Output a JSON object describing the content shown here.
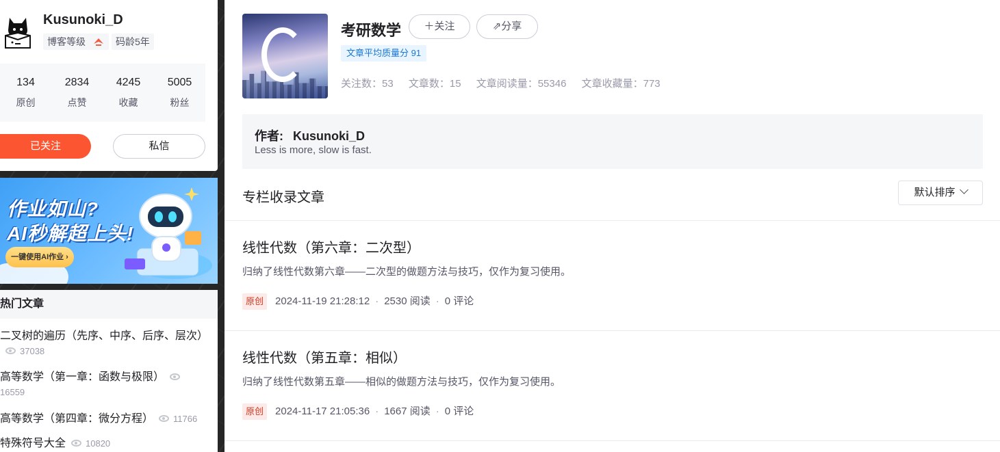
{
  "profile": {
    "name": "Kusunoki_D",
    "level_label": "博客等级",
    "age_label": "码龄5年",
    "stats": [
      {
        "num": "134",
        "label": "原创"
      },
      {
        "num": "2834",
        "label": "点赞"
      },
      {
        "num": "4245",
        "label": "收藏"
      },
      {
        "num": "5005",
        "label": "粉丝"
      }
    ],
    "followed_label": "已关注",
    "message_label": "私信"
  },
  "ad": {
    "line1": "作业如山?",
    "line2": "AI秒解超上头!",
    "cta": "一键使用AI作业 ›"
  },
  "hot": {
    "header": "热门文章",
    "items": [
      {
        "title": "二叉树的遍历（先序、中序、后序、层次）",
        "views": "37038"
      },
      {
        "title": "高等数学（第一章：函数与极限）",
        "views": "16559"
      },
      {
        "title": "高等数学（第四章：微分方程）",
        "views": "11766"
      },
      {
        "title": "特殊符号大全",
        "views": "10820"
      }
    ]
  },
  "column": {
    "title": "考研数学",
    "follow_label": "＋关注",
    "share_label": "分享",
    "quality": "文章平均质量分 91",
    "meta": [
      "关注数：53",
      "文章数：15",
      "文章阅读量：55346",
      "文章收藏量：773"
    ],
    "author_label": "作者:",
    "author_name": "Kusunoki_D",
    "author_desc": "Less is more, slow is fast."
  },
  "list": {
    "section_title": "专栏收录文章",
    "sort_label": "默认排序",
    "articles": [
      {
        "title": "线性代数（第六章：二次型）",
        "desc": "归纳了线性代数第六章——二次型的做题方法与技巧，仅作为复习使用。",
        "tag": "原创",
        "date": "2024-11-19 21:28:12",
        "reads": "2530 阅读",
        "comments": "0 评论"
      },
      {
        "title": "线性代数（第五章：相似）",
        "desc": "归纳了线性代数第五章——相似的做题方法与技巧，仅作为复习使用。",
        "tag": "原创",
        "date": "2024-11-17 21:05:36",
        "reads": "1667 阅读",
        "comments": "0 评论"
      }
    ]
  },
  "colors": {
    "accent": "#fc5531",
    "tag_blue": "#1977d6",
    "tag_red": "#d53a26"
  }
}
